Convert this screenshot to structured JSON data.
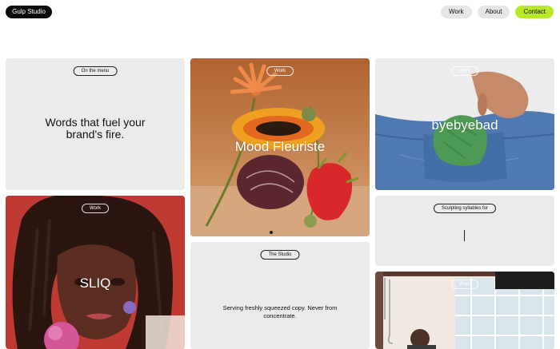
{
  "header": {
    "logo": "Gulp Studio",
    "nav": {
      "work": "Work",
      "about": "About",
      "contact": "Contact"
    }
  },
  "cards": {
    "menu": {
      "pill": "On the menu",
      "headline": "Words that fuel your brand's fire."
    },
    "mood": {
      "pill": "Work",
      "title": "Mood Fleuriste"
    },
    "byebye": {
      "pill": "Work",
      "title": "byebyebad"
    },
    "sliq": {
      "pill": "Work",
      "title": "SLIQ"
    },
    "sculpt": {
      "pill": "Sculpting syllables for"
    },
    "studio": {
      "pill": "The Studio",
      "text": "Serving freshly squeezed copy. Never from concentrate."
    },
    "gym": {
      "pill": "Work"
    }
  },
  "colors": {
    "accent": "#b7e928",
    "card_grey": "#ebebeb",
    "logo_bg": "#0b0b0b"
  }
}
